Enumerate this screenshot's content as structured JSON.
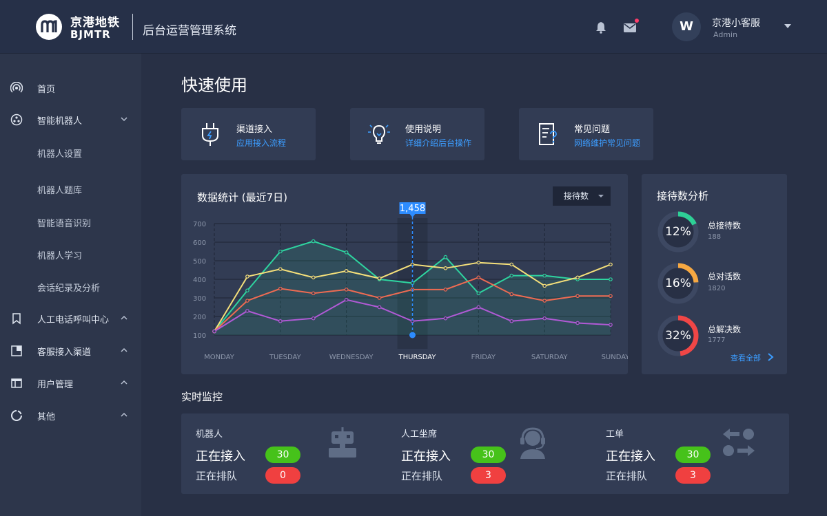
{
  "brand": {
    "cn": "京港地铁",
    "en": "BJMTR",
    "system_title": "后台运营管理系统"
  },
  "header": {
    "icons": [
      "bell-icon",
      "mail-icon"
    ],
    "user": {
      "avatar": "W",
      "name": "京港小客服",
      "role": "Admin"
    }
  },
  "sidebar": {
    "items": [
      {
        "label": "首页",
        "icon": "broadcast-icon"
      },
      {
        "label": "智能机器人",
        "icon": "robot-hub-icon",
        "expanded": true,
        "children": [
          "机器人设置",
          "机器人题库",
          "智能语音识别",
          "机器人学习",
          "会话纪录及分析"
        ]
      },
      {
        "label": "人工电话呼叫中心",
        "icon": "bookmark-icon",
        "expanded": false
      },
      {
        "label": "客服接入渠道",
        "icon": "panel-icon",
        "expanded": false
      },
      {
        "label": "用户管理",
        "icon": "table-icon",
        "expanded": false
      },
      {
        "label": "其他",
        "icon": "circle-arc-icon",
        "expanded": false
      }
    ]
  },
  "main": {
    "title": "快速使用",
    "quick": [
      {
        "title": "渠道接入",
        "subtitle": "应用接入流程",
        "icon": "plug-icon"
      },
      {
        "title": "使用说明",
        "subtitle": "详细介绍后台操作",
        "icon": "lightbulb-icon"
      },
      {
        "title": "常见问题",
        "subtitle": "网络维护常见问题",
        "icon": "faq-doc-icon"
      }
    ],
    "stats": {
      "title": "数据统计 (最近7日)",
      "select_value": "接待数",
      "tooltip": "1,458",
      "highlighted": "THURSDAY"
    },
    "analysis": {
      "title": "接待数分析",
      "items": [
        {
          "pct": "12%",
          "name": "总接待数",
          "value": "188",
          "fraction": 0.12,
          "color": "#2ed096"
        },
        {
          "pct": "16%",
          "name": "总对话数",
          "value": "1820",
          "fraction": 0.16,
          "color": "#f6a842"
        },
        {
          "pct": "32%",
          "name": "总解决数",
          "value": "1777",
          "fraction": 0.32,
          "color": "#f04646"
        }
      ],
      "view_all": "查看全部"
    },
    "monitor": {
      "title": "实时监控",
      "groups": [
        {
          "name": "机器人",
          "l1": "正在接入",
          "v1": "30",
          "l2": "正在排队",
          "v2": "0",
          "icon": "robot-icon"
        },
        {
          "name": "人工坐席",
          "l1": "正在接入",
          "v1": "30",
          "l2": "正在排队",
          "v2": "3",
          "icon": "headset-agent-icon"
        },
        {
          "name": "工单",
          "l1": "正在接入",
          "v1": "30",
          "l2": "正在排队",
          "v2": "3",
          "icon": "transfer-icon"
        }
      ]
    }
  },
  "chart_data": {
    "type": "line",
    "categories": [
      "MONDAY",
      "TUESDAY",
      "WEDNESDAY",
      "THURSDAY",
      "FRIDAY",
      "SATURDAY",
      "SUNDAY"
    ],
    "x": [
      0,
      0.5,
      1,
      1.5,
      2,
      2.5,
      3,
      3.5,
      4,
      4.5,
      5,
      5.5,
      6
    ],
    "ylim": [
      100,
      700
    ],
    "yticks": [
      700,
      600,
      500,
      400,
      300,
      200,
      100
    ],
    "grid": true,
    "series": [
      {
        "color": "#2ed5a0",
        "values": [
          120,
          340,
          550,
          605,
          545,
          400,
          380,
          520,
          325,
          420,
          420,
          400,
          400
        ]
      },
      {
        "color": "#f5e07a",
        "values": [
          120,
          415,
          455,
          410,
          445,
          405,
          480,
          460,
          490,
          480,
          365,
          410,
          480
        ]
      },
      {
        "color": "#ef6b52",
        "values": [
          120,
          285,
          350,
          325,
          345,
          300,
          345,
          345,
          410,
          320,
          285,
          310,
          310
        ]
      },
      {
        "color": "#b15ad6",
        "values": [
          120,
          230,
          175,
          190,
          290,
          250,
          175,
          190,
          250,
          175,
          190,
          165,
          155
        ]
      }
    ],
    "highlight": {
      "x": 3,
      "label": "1,458"
    }
  }
}
